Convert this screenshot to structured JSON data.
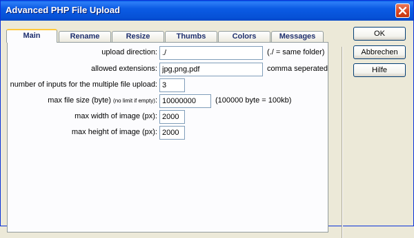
{
  "window": {
    "title": "Advanced PHP File Upload"
  },
  "tabs": [
    {
      "label": "Main",
      "active": true
    },
    {
      "label": "Rename",
      "active": false
    },
    {
      "label": "Resize",
      "active": false
    },
    {
      "label": "Thumbs",
      "active": false
    },
    {
      "label": "Colors",
      "active": false
    },
    {
      "label": "Messages",
      "active": false
    }
  ],
  "fields": {
    "upload_direction": {
      "label": "upload direction:",
      "value": "./",
      "hint": "(./ = same folder)"
    },
    "allowed_extensions": {
      "label": "allowed extensions:",
      "value": "jpg,png,pdf",
      "hint": "comma seperated"
    },
    "number_of_inputs": {
      "label": "number of inputs for the multiple file upload:",
      "value": "3"
    },
    "max_file_size": {
      "label": "max file size (byte)",
      "label_note": "(no limit if empty)",
      "label_colon": ":",
      "value": "10000000",
      "hint": "(100000 byte = 100kb)"
    },
    "max_width": {
      "label": "max width of image (px):",
      "value": "2000"
    },
    "max_height": {
      "label": "max height of image (px):",
      "value": "2000"
    }
  },
  "buttons": {
    "ok": "OK",
    "cancel": "Abbrechen",
    "help": "Hilfe"
  },
  "icons": {
    "close": "close-icon"
  },
  "colors": {
    "titlebar": "#0a5fe8",
    "close": "#d8431e",
    "active_tab_accent": "#ffc83c",
    "dialog_bg": "#ece9d8"
  }
}
